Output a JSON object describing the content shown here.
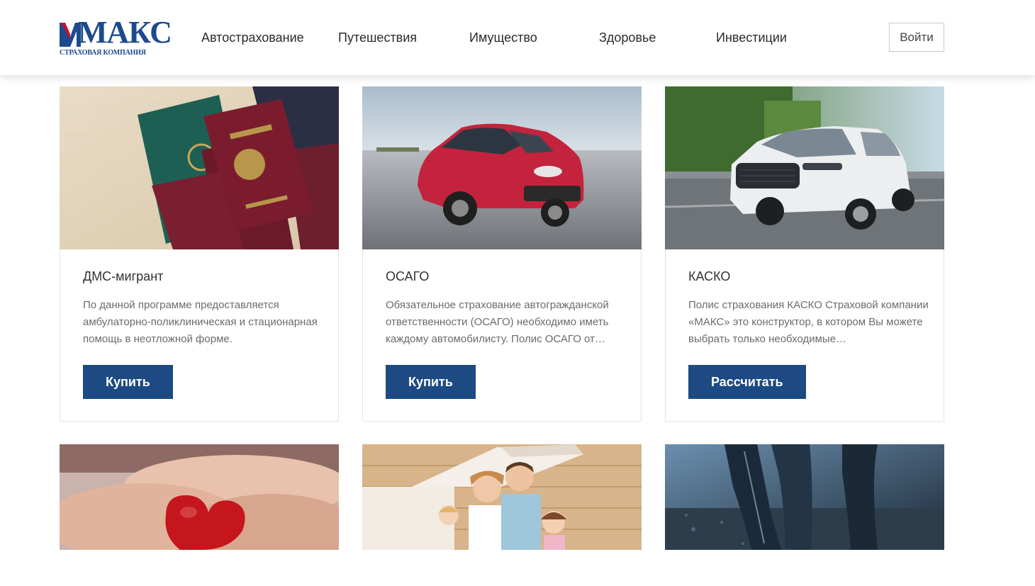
{
  "brand": {
    "name": "МАКС",
    "subtitle": "СТРАХОВАЯ КОМПАНИЯ",
    "color": "#1d4a8c",
    "accent": "#c8102e"
  },
  "nav": {
    "items": [
      {
        "label": "Автострахование"
      },
      {
        "label": "Путешествия"
      },
      {
        "label": "Имущество"
      },
      {
        "label": "Здоровье"
      },
      {
        "label": "Инвестиции"
      }
    ],
    "login_label": "Войти"
  },
  "cards": [
    {
      "title": "ДМС-мигрант",
      "description": "По данной программе предоставляется амбулаторно-поликлиническая и стационарная помощь в неотложной форме.",
      "button": "Купить",
      "image": "passports"
    },
    {
      "title": "ОСАГО",
      "description": "Обязательное страхование автогражданской ответственности (ОСАГО) необходимо иметь каждому автомобилисту. Полис ОСАГО от…",
      "button": "Купить",
      "image": "red-car"
    },
    {
      "title": "КАСКО",
      "description": "Полис страхования КАСКО Страховой компании «МАКС» это конструктор, в котором Вы можете выбрать только необходимые…",
      "button": "Рассчитать",
      "image": "white-suv"
    },
    {
      "image": "hands-heart"
    },
    {
      "image": "family-house"
    },
    {
      "image": "runner-legs"
    }
  ],
  "colors": {
    "button": "#1d4a82",
    "card_border": "#e3e3e3"
  }
}
